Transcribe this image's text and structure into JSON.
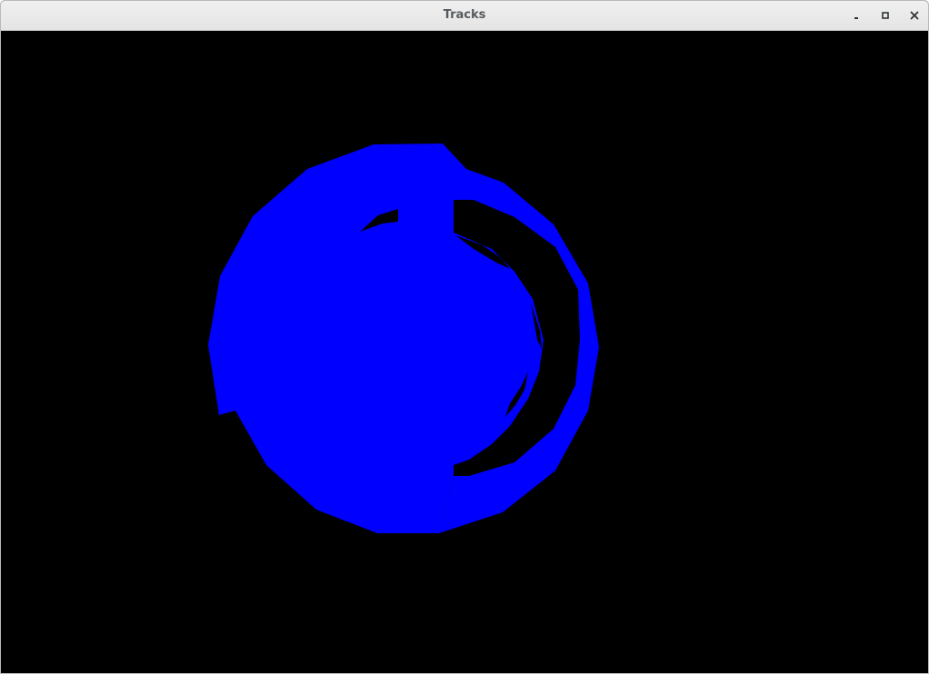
{
  "window": {
    "title": "Tracks",
    "controls": {
      "minimize": "minimize",
      "maximize": "maximize",
      "close": "close"
    }
  },
  "scene": {
    "background_color": "#000000",
    "track_color": "#0000ff"
  }
}
